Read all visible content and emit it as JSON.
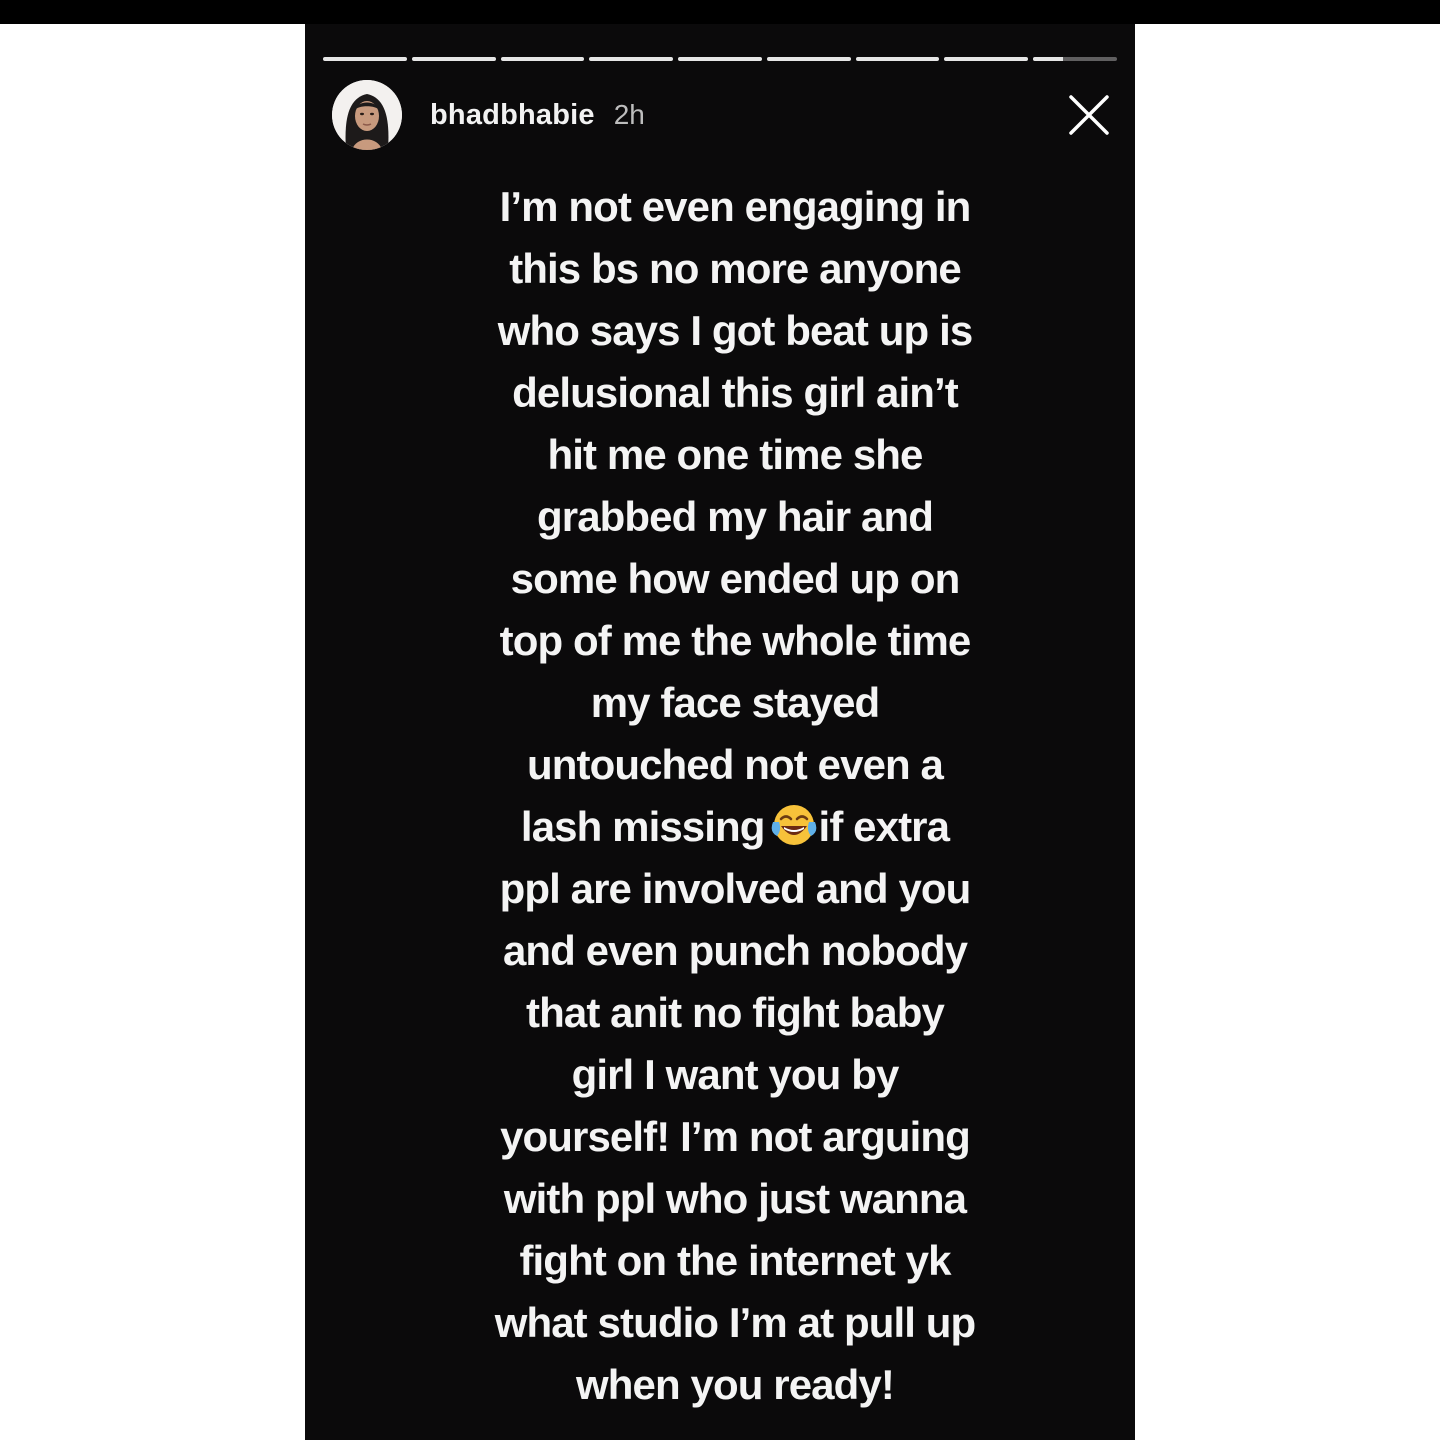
{
  "story": {
    "progress_segments": [
      {
        "fill": 1
      },
      {
        "fill": 1
      },
      {
        "fill": 1
      },
      {
        "fill": 1
      },
      {
        "fill": 1
      },
      {
        "fill": 1
      },
      {
        "fill": 1
      },
      {
        "fill": 1
      },
      {
        "fill": 0.35
      }
    ],
    "header": {
      "username": "bhadbhabie",
      "timestamp": "2h",
      "close_icon": "close-icon"
    },
    "caption_lines": [
      "I’m not even engaging in",
      "this bs no more anyone",
      "who says I got beat up is",
      "delusional this girl ain’t",
      "hit me one time she",
      "grabbed my hair and",
      "some how ended up on",
      "top of me the whole time",
      "my face stayed",
      "untouched not even a",
      "lash missing",
      "if extra",
      "ppl are involved and you",
      "and even punch nobody",
      "that anit no fight baby",
      "girl I want you by",
      "yourself! I’m not arguing",
      "with ppl who just wanna",
      "fight on the internet yk",
      "what studio I’m at pull up",
      "when you ready!"
    ],
    "emoji": "face-with-tears-of-joy",
    "colors": {
      "background": "#0b0a0b",
      "text": "#f4f4f4",
      "progress_active": "#e6e6e6"
    }
  }
}
